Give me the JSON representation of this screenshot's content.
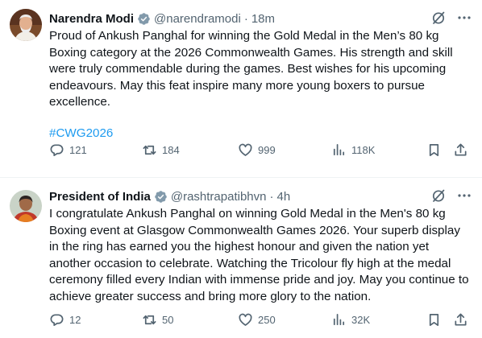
{
  "tweets": [
    {
      "author": "Narendra Modi",
      "handle": "@narendramodi",
      "separator": "·",
      "time": "18m",
      "text": "Proud of Ankush Panghal for winning the Gold Medal in the Men’s 80 kg Boxing category at the 2026 Commonwealth Games. His strength and skill were truly commendable during the games. Best wishes for his upcoming endeavours. May this feat inspire many more young boxers to pursue excellence.",
      "hashtag": "#CWG2026",
      "replies": "121",
      "reposts": "184",
      "likes": "999",
      "views": "118K"
    },
    {
      "author": "President of India",
      "handle": "@rashtrapatibhvn",
      "separator": "·",
      "time": "4h",
      "text": "I congratulate Ankush Panghal on winning Gold Medal in the Men's 80 kg Boxing event at Glasgow Commonwealth Games 2026. Your superb display in the ring has earned you the highest honour and given the nation yet another occasion to celebrate. Watching the Tricolour fly high at the medal ceremony filled every Indian with immense pride and joy. May you continue to achieve greater success and bring more glory to the nation.",
      "replies": "12",
      "reposts": "50",
      "likes": "250",
      "views": "32K"
    }
  ],
  "colors": {
    "text": "#0f1419",
    "secondary": "#536471",
    "link": "#1d9bf0",
    "verified_badge": "#829aab",
    "divider": "#eff3f4"
  },
  "icons": [
    "verified-badge-icon",
    "grok-icon",
    "more-icon",
    "reply-icon",
    "repost-icon",
    "like-icon",
    "views-icon",
    "bookmark-icon",
    "share-icon"
  ]
}
